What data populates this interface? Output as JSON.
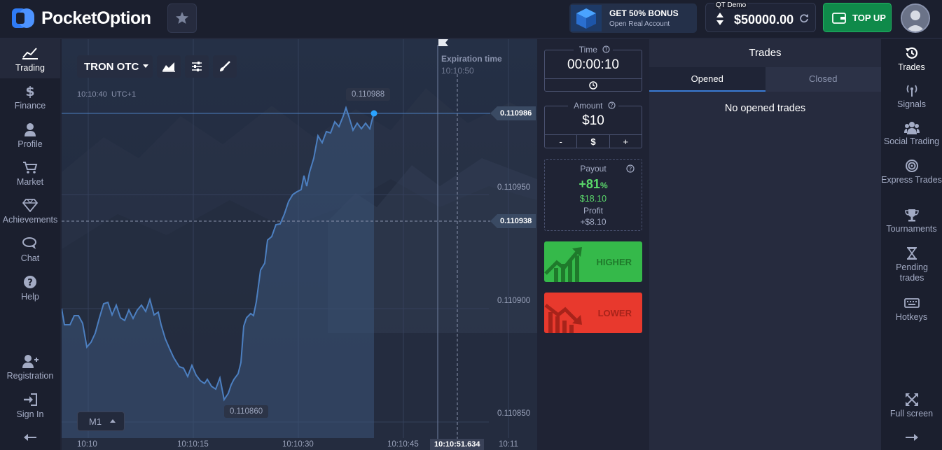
{
  "header": {
    "logo_text": "PocketOption",
    "bonus_title": "GET 50% BONUS",
    "bonus_subtitle": "Open Real Account",
    "account_label": "QT Demo",
    "balance": "$50000.00",
    "topup_label": "TOP UP"
  },
  "left_nav": [
    {
      "label": "Trading",
      "icon": "chart-line-icon"
    },
    {
      "label": "Finance",
      "icon": "dollar-icon"
    },
    {
      "label": "Profile",
      "icon": "user-icon"
    },
    {
      "label": "Market",
      "icon": "cart-icon"
    },
    {
      "label": "Achievements",
      "icon": "diamond-icon"
    },
    {
      "label": "Chat",
      "icon": "chat-icon"
    },
    {
      "label": "Help",
      "icon": "help-icon"
    },
    {
      "label": "Registration",
      "icon": "user-plus-icon"
    },
    {
      "label": "Sign In",
      "icon": "sign-in-icon"
    }
  ],
  "chart": {
    "asset": "TRON OTC",
    "timestamp": "10:10:40",
    "timezone": "UTC+1",
    "expiration_label": "Expiration time",
    "expiration_time": "10:10:50",
    "max_label": "0.110988",
    "min_label": "0.110860",
    "current_price": "0.110986",
    "strike_price": "0.110938",
    "price_levels": [
      "0.110950",
      "0.110900",
      "0.110850"
    ],
    "timeframe": "M1",
    "time_ticks": [
      "10:10",
      "10:10:15",
      "10:10:30",
      "10:10:45",
      "10:11"
    ],
    "current_time": "10:10:51.634",
    "colors": {
      "line": "#4c7fc0",
      "area": "#3a5479",
      "current": "#2aa3ff"
    }
  },
  "trade_panel": {
    "time_label": "Time",
    "time_value": "00:00:10",
    "amount_label": "Amount",
    "amount_value": "$10",
    "minus": "-",
    "currency": "$",
    "plus": "+",
    "payout_label": "Payout",
    "payout_pct": "+81",
    "payout_pct_suffix": "%",
    "payout_amount": "$18.10",
    "profit_label": "Profit",
    "profit_value": "+$8.10",
    "higher_label": "HIGHER",
    "lower_label": "LOWER",
    "colors": {
      "higher": "#35b94a",
      "lower": "#e8392d"
    }
  },
  "trades": {
    "title": "Trades",
    "tab_opened": "Opened",
    "tab_closed": "Closed",
    "empty_text": "No opened trades"
  },
  "right_nav": [
    {
      "label": "Trades",
      "icon": "history-icon"
    },
    {
      "label": "Signals",
      "icon": "signal-icon"
    },
    {
      "label": "Social Trading",
      "icon": "users-icon"
    },
    {
      "label": "Express Trades",
      "icon": "target-icon"
    },
    {
      "label": "Tournaments",
      "icon": "trophy-icon"
    },
    {
      "label": "Pending trades",
      "icon": "hourglass-icon"
    },
    {
      "label": "Hotkeys",
      "icon": "keyboard-icon"
    },
    {
      "label": "Full screen",
      "icon": "fullscreen-icon"
    }
  ]
}
